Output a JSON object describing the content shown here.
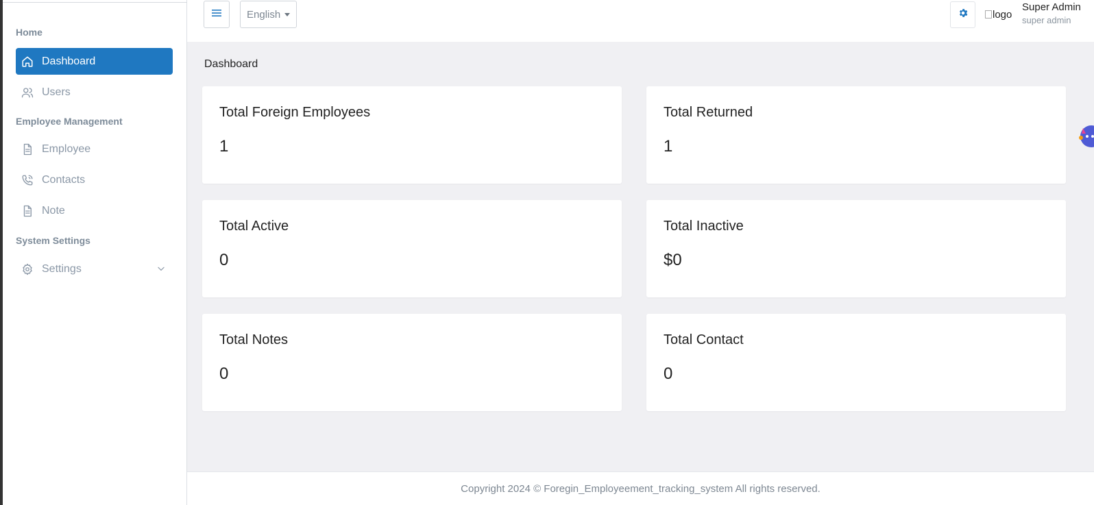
{
  "sidebar": {
    "sections": [
      {
        "title": "Home"
      },
      {
        "title": "Employee Management"
      },
      {
        "title": "System Settings"
      }
    ],
    "items": [
      {
        "label": "Dashboard",
        "icon": "home-icon",
        "active": true
      },
      {
        "label": "Users",
        "icon": "users-icon"
      },
      {
        "label": "Employee",
        "icon": "document-icon"
      },
      {
        "label": "Contacts",
        "icon": "phone-icon"
      },
      {
        "label": "Note",
        "icon": "document-icon"
      },
      {
        "label": "Settings",
        "icon": "gear-icon",
        "expandable": true
      }
    ]
  },
  "topbar": {
    "language": "English",
    "avatar_alt": "logo",
    "user_name": "Super Admin",
    "user_role": "super admin"
  },
  "main": {
    "page_title": "Dashboard",
    "cards": [
      {
        "title": "Total Foreign Employees",
        "value": "1"
      },
      {
        "title": "Total Returned",
        "value": "1"
      },
      {
        "title": "Total Active",
        "value": "0"
      },
      {
        "title": "Total Inactive",
        "value": "$0"
      },
      {
        "title": "Total Notes",
        "value": "0"
      },
      {
        "title": "Total Contact",
        "value": "0"
      }
    ]
  },
  "footer": {
    "text": "Copyright 2024 © Foregin_Employeement_tracking_system All rights reserved."
  },
  "colors": {
    "accent": "#1f78c1",
    "content_bg": "#f0f0f3",
    "muted_text": "#8a97a6"
  }
}
